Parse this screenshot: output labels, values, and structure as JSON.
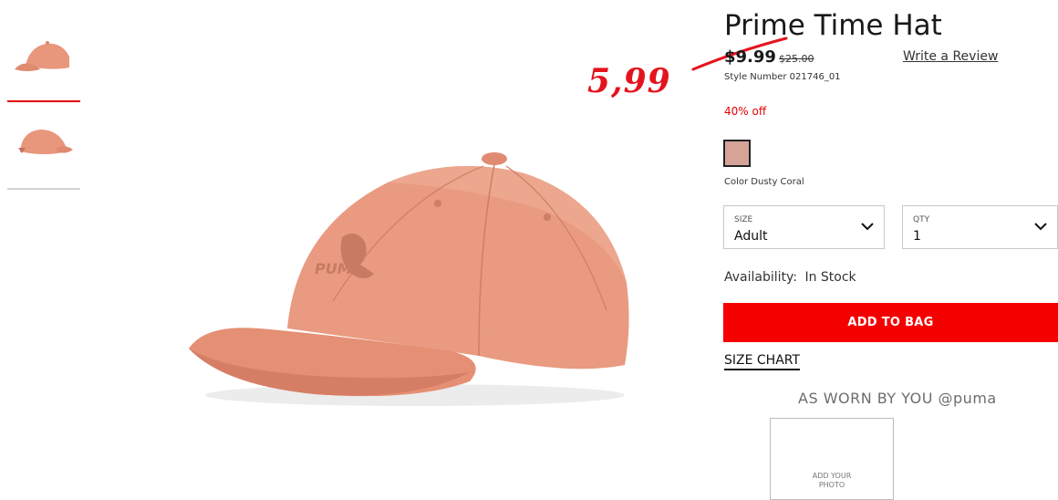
{
  "annotation": {
    "new_price": "5,99"
  },
  "product": {
    "title": "Prime Time Hat",
    "price": "$9.99",
    "original_price": "$25.00",
    "review_link": "Write a Review",
    "style_number": "Style Number 021746_01",
    "discount": "40% off",
    "color_label": "Color Dusty Coral",
    "swatch_color": "#d6a397"
  },
  "selectors": {
    "size": {
      "label": "SIZE",
      "value": "Adult"
    },
    "qty": {
      "label": "QTY",
      "value": "1"
    }
  },
  "availability": {
    "label": "Availability:",
    "value": "In Stock"
  },
  "add_to_bag": "ADD TO BAG",
  "size_chart": "SIZE CHART",
  "ugc": {
    "heading": "AS WORN BY YOU @puma",
    "upload_line1": "ADD YOUR",
    "upload_line2": "PHOTO"
  },
  "thumbnails": [
    "hat-side-view",
    "hat-back-view"
  ],
  "colors": {
    "accent": "#f50000",
    "hat": "#e8967c"
  }
}
